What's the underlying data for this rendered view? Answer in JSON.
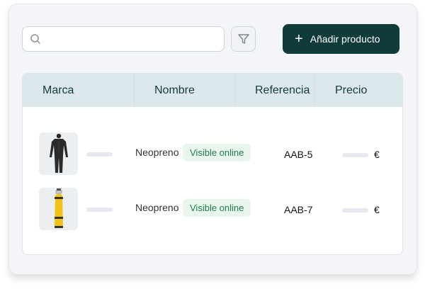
{
  "toolbar": {
    "search": {
      "value": "",
      "placeholder": ""
    },
    "search_icon": "search-icon",
    "filter_icon": "filter-icon",
    "add_button_icon": "plus-icon",
    "add_button_label": "Añadir producto"
  },
  "table": {
    "columns": [
      "Marca",
      "Nombre",
      "Referencia",
      "Precio"
    ],
    "rows": [
      {
        "image": "wetsuit-image",
        "name": "Neopreno",
        "badge": "Visible online",
        "reference": "AAB-5",
        "currency": "€"
      },
      {
        "image": "tank-image",
        "name": "Neopreno",
        "badge": "Visible online",
        "reference": "AAB-7",
        "currency": "€"
      }
    ]
  },
  "colors": {
    "primary": "#0f3b3a",
    "header_bg": "#dde8ec",
    "badge_bg": "#e8f6ee",
    "badge_text": "#1f7a48",
    "panel_bg": "#f3f5f8"
  }
}
